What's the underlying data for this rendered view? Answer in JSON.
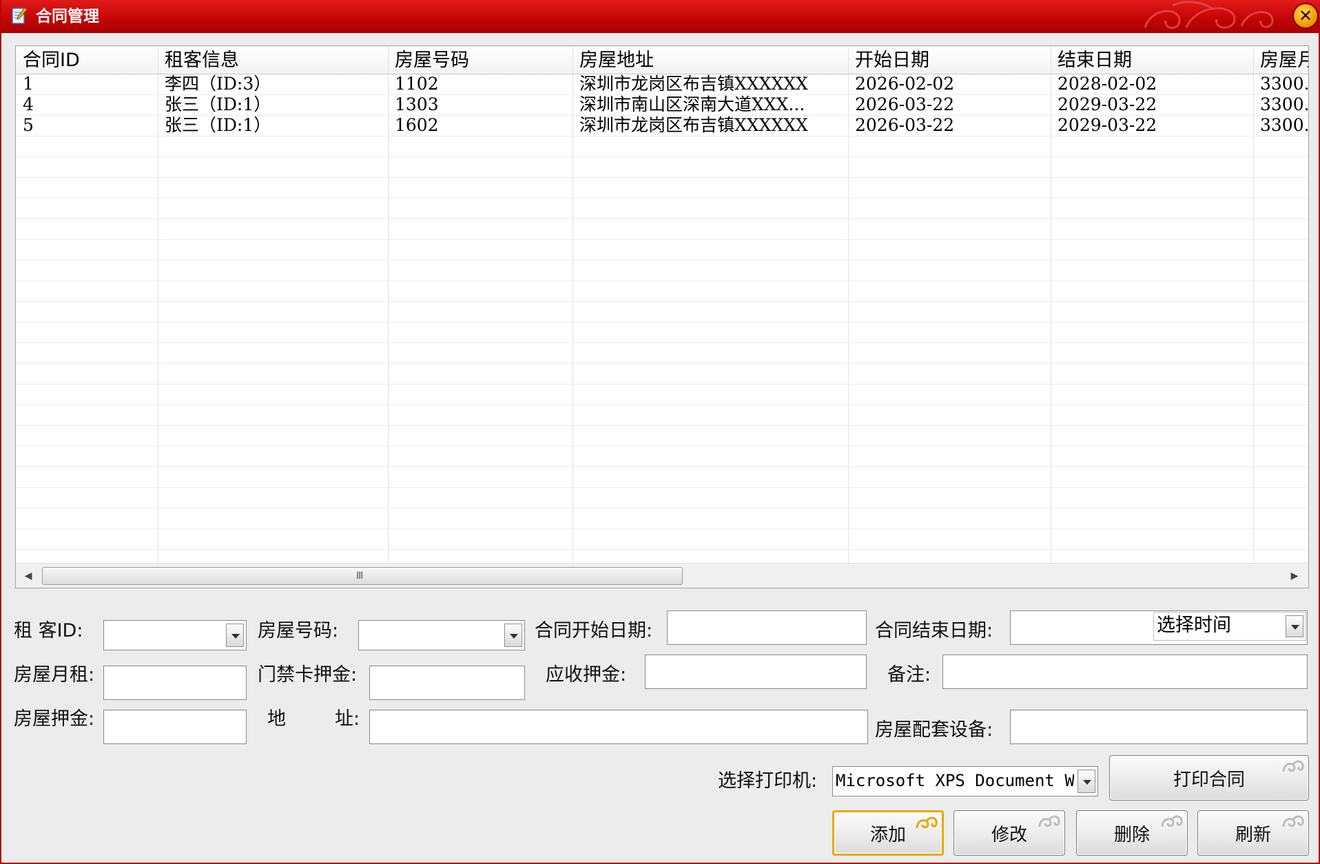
{
  "window": {
    "title": "合同管理"
  },
  "grid": {
    "columns": [
      "合同ID",
      "租客信息",
      "房屋号码",
      "房屋地址",
      "开始日期",
      "结束日期",
      "房屋月"
    ],
    "rows": [
      [
        "1",
        "李四（ID:3）",
        "1102",
        "深圳市龙岗区布吉镇XXXXXX",
        "2026-02-02",
        "2028-02-02",
        "3300."
      ],
      [
        "4",
        "张三（ID:1）",
        "1303",
        "深圳市南山区深南大道XXX...",
        "2026-03-22",
        "2029-03-22",
        "3300."
      ],
      [
        "5",
        "张三（ID:1）",
        "1602",
        "深圳市龙岗区布吉镇XXXXXX",
        "2026-03-22",
        "2029-03-22",
        "3300."
      ]
    ],
    "scroll_grip": "III"
  },
  "form": {
    "tenant_id_label": "租 客ID:",
    "tenant_id_value": "",
    "house_no_label": "房屋号码:",
    "house_no_value": "",
    "start_date_label": "合同开始日期:",
    "start_date_value": "",
    "end_date_label": "合同结束日期:",
    "end_date_value": "",
    "time_picker_label": "选择时间",
    "monthly_rent_label": "房屋月租:",
    "monthly_rent_value": "",
    "card_deposit_label": "门禁卡押金:",
    "card_deposit_value": "",
    "receivable_deposit_label": "应收押金:",
    "receivable_deposit_value": "",
    "remark_label": "备注:",
    "remark_value": "",
    "house_deposit_label": "房屋押金:",
    "house_deposit_value": "",
    "address_label_a": "地",
    "address_label_b": "址:",
    "address_value": "",
    "facilities_label": "房屋配套设备:",
    "facilities_value": "",
    "printer_label": "选择打印机:",
    "printer_value": "Microsoft XPS Document W"
  },
  "buttons": {
    "print": "打印合同",
    "add": "添加",
    "edit": "修改",
    "delete": "删除",
    "refresh": "刷新"
  },
  "colors": {
    "titlebar": "#c40606",
    "accent": "#e6a800",
    "background": "#ececec"
  },
  "icons": {
    "app": "notepad-pencil-icon",
    "close": "close-icon",
    "scroll_left": "arrow-left-icon",
    "scroll_right": "arrow-right-icon",
    "dropdown": "chevron-down-icon",
    "button_decoration": "swirl-ornament-icon"
  }
}
